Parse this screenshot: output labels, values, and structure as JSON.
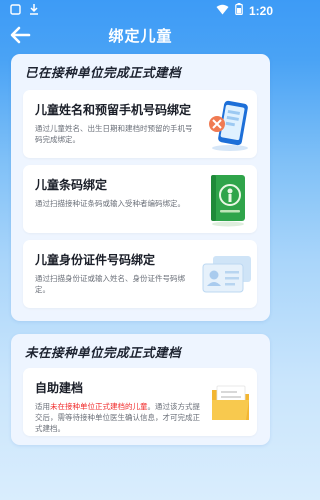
{
  "status_bar": {
    "time": "1:20",
    "left_icons": [
      "square-icon",
      "download-icon"
    ],
    "right_icons": [
      "wifi-icon",
      "battery-icon"
    ]
  },
  "header": {
    "title": "绑定儿童",
    "back_icon": "arrow-left-icon"
  },
  "section_archived": {
    "title": "已在接种单位完成正式建档",
    "cards": [
      {
        "title": "儿童姓名和预留手机号码绑定",
        "description": "通过儿童姓名、出生日期和建档时预留的手机号码完成绑定。",
        "icon": "phone-icon"
      },
      {
        "title": "儿童条码绑定",
        "description": "通过扫描接种证条码或输入受种者编码绑定。",
        "icon": "vaccination-book-icon"
      },
      {
        "title": "儿童身份证件号码绑定",
        "description": "通过扫描身份证或输入姓名、身份证件号码绑定。",
        "icon": "id-card-icon"
      }
    ]
  },
  "section_unarchived": {
    "title": "未在接种单位完成正式建档",
    "card": {
      "title": "自助建档",
      "desc_prefix": "适用",
      "desc_highlight": "未在接种单位正式建档的儿童",
      "desc_suffix": "。通过该方式提交后，需等待接种单位医生确认信息，才可完成正式建档。",
      "icon": "folder-icon"
    }
  },
  "colors": {
    "accent": "#3d9bf6",
    "highlight": "#f02a2a",
    "section_bg": "#eef5ff"
  }
}
